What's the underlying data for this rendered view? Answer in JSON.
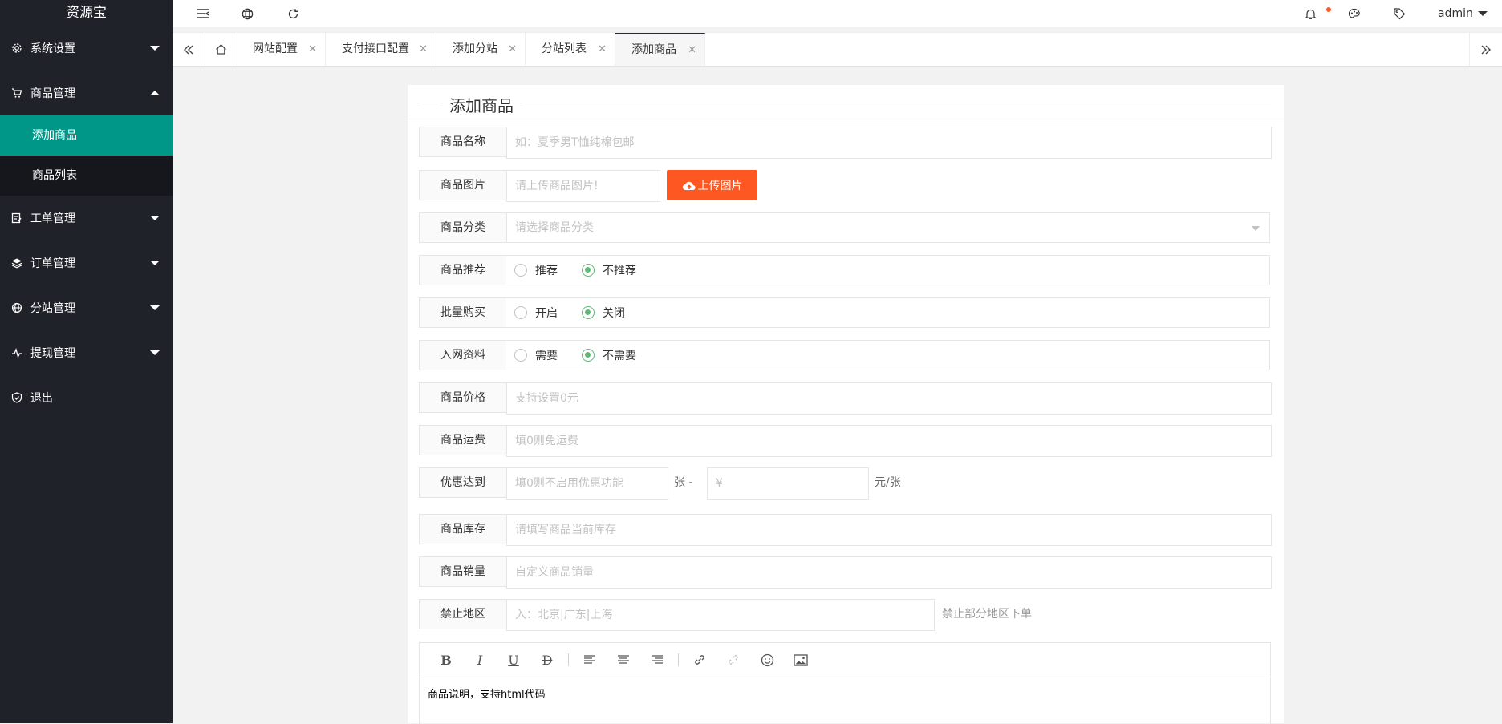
{
  "app": {
    "logo": "资源宝"
  },
  "topbar": {
    "user": "admin"
  },
  "sidebar": {
    "items": [
      {
        "label": "系统设置",
        "icon": "gear-icon"
      },
      {
        "label": "商品管理",
        "icon": "cart-icon",
        "expanded": true,
        "children": [
          {
            "label": "添加商品",
            "active": true
          },
          {
            "label": "商品列表"
          }
        ]
      },
      {
        "label": "工单管理",
        "icon": "ticket-icon"
      },
      {
        "label": "订单管理",
        "icon": "layers-icon"
      },
      {
        "label": "分站管理",
        "icon": "globe-icon"
      },
      {
        "label": "提现管理",
        "icon": "pulse-icon"
      },
      {
        "label": "退出",
        "icon": "shield-icon"
      }
    ]
  },
  "tabs": [
    {
      "label": "网站配置"
    },
    {
      "label": "支付接口配置"
    },
    {
      "label": "添加分站"
    },
    {
      "label": "分站列表"
    },
    {
      "label": "添加商品",
      "active": true
    }
  ],
  "form": {
    "title": "添加商品",
    "name": {
      "label": "商品名称",
      "placeholder": "如：夏季男T恤纯棉包邮"
    },
    "image": {
      "label": "商品图片",
      "placeholder": "请上传商品图片!",
      "button": "上传图片"
    },
    "category": {
      "label": "商品分类",
      "placeholder": "请选择商品分类"
    },
    "recommend": {
      "label": "商品推荐",
      "options": [
        "推荐",
        "不推荐"
      ],
      "selected": "不推荐"
    },
    "bulk": {
      "label": "批量购买",
      "options": [
        "开启",
        "关闭"
      ],
      "selected": "关闭"
    },
    "netinfo": {
      "label": "入网资料",
      "options": [
        "需要",
        "不需要"
      ],
      "selected": "不需要"
    },
    "price": {
      "label": "商品价格",
      "placeholder": "支持设置0元"
    },
    "shipping": {
      "label": "商品运费",
      "placeholder": "填0则免运费"
    },
    "discount": {
      "label": "优惠达到",
      "placeholder_qty": "填0则不启用优惠功能",
      "mid": "张 -",
      "placeholder_price": "¥",
      "suffix": "元/张"
    },
    "stock": {
      "label": "商品库存",
      "placeholder": "请填写商品当前库存"
    },
    "sales": {
      "label": "商品销量",
      "placeholder": "自定义商品销量"
    },
    "region": {
      "label": "禁止地区",
      "placeholder": "入：北京|广东|上海",
      "hint": "禁止部分地区下单"
    },
    "editor": {
      "content": "商品说明，支持html代码"
    }
  },
  "colors": {
    "sidebar": "#20222a",
    "active": "#009688",
    "upload": "#ff5722",
    "radio_on": "#5fb878",
    "badge": "#ff5722"
  }
}
